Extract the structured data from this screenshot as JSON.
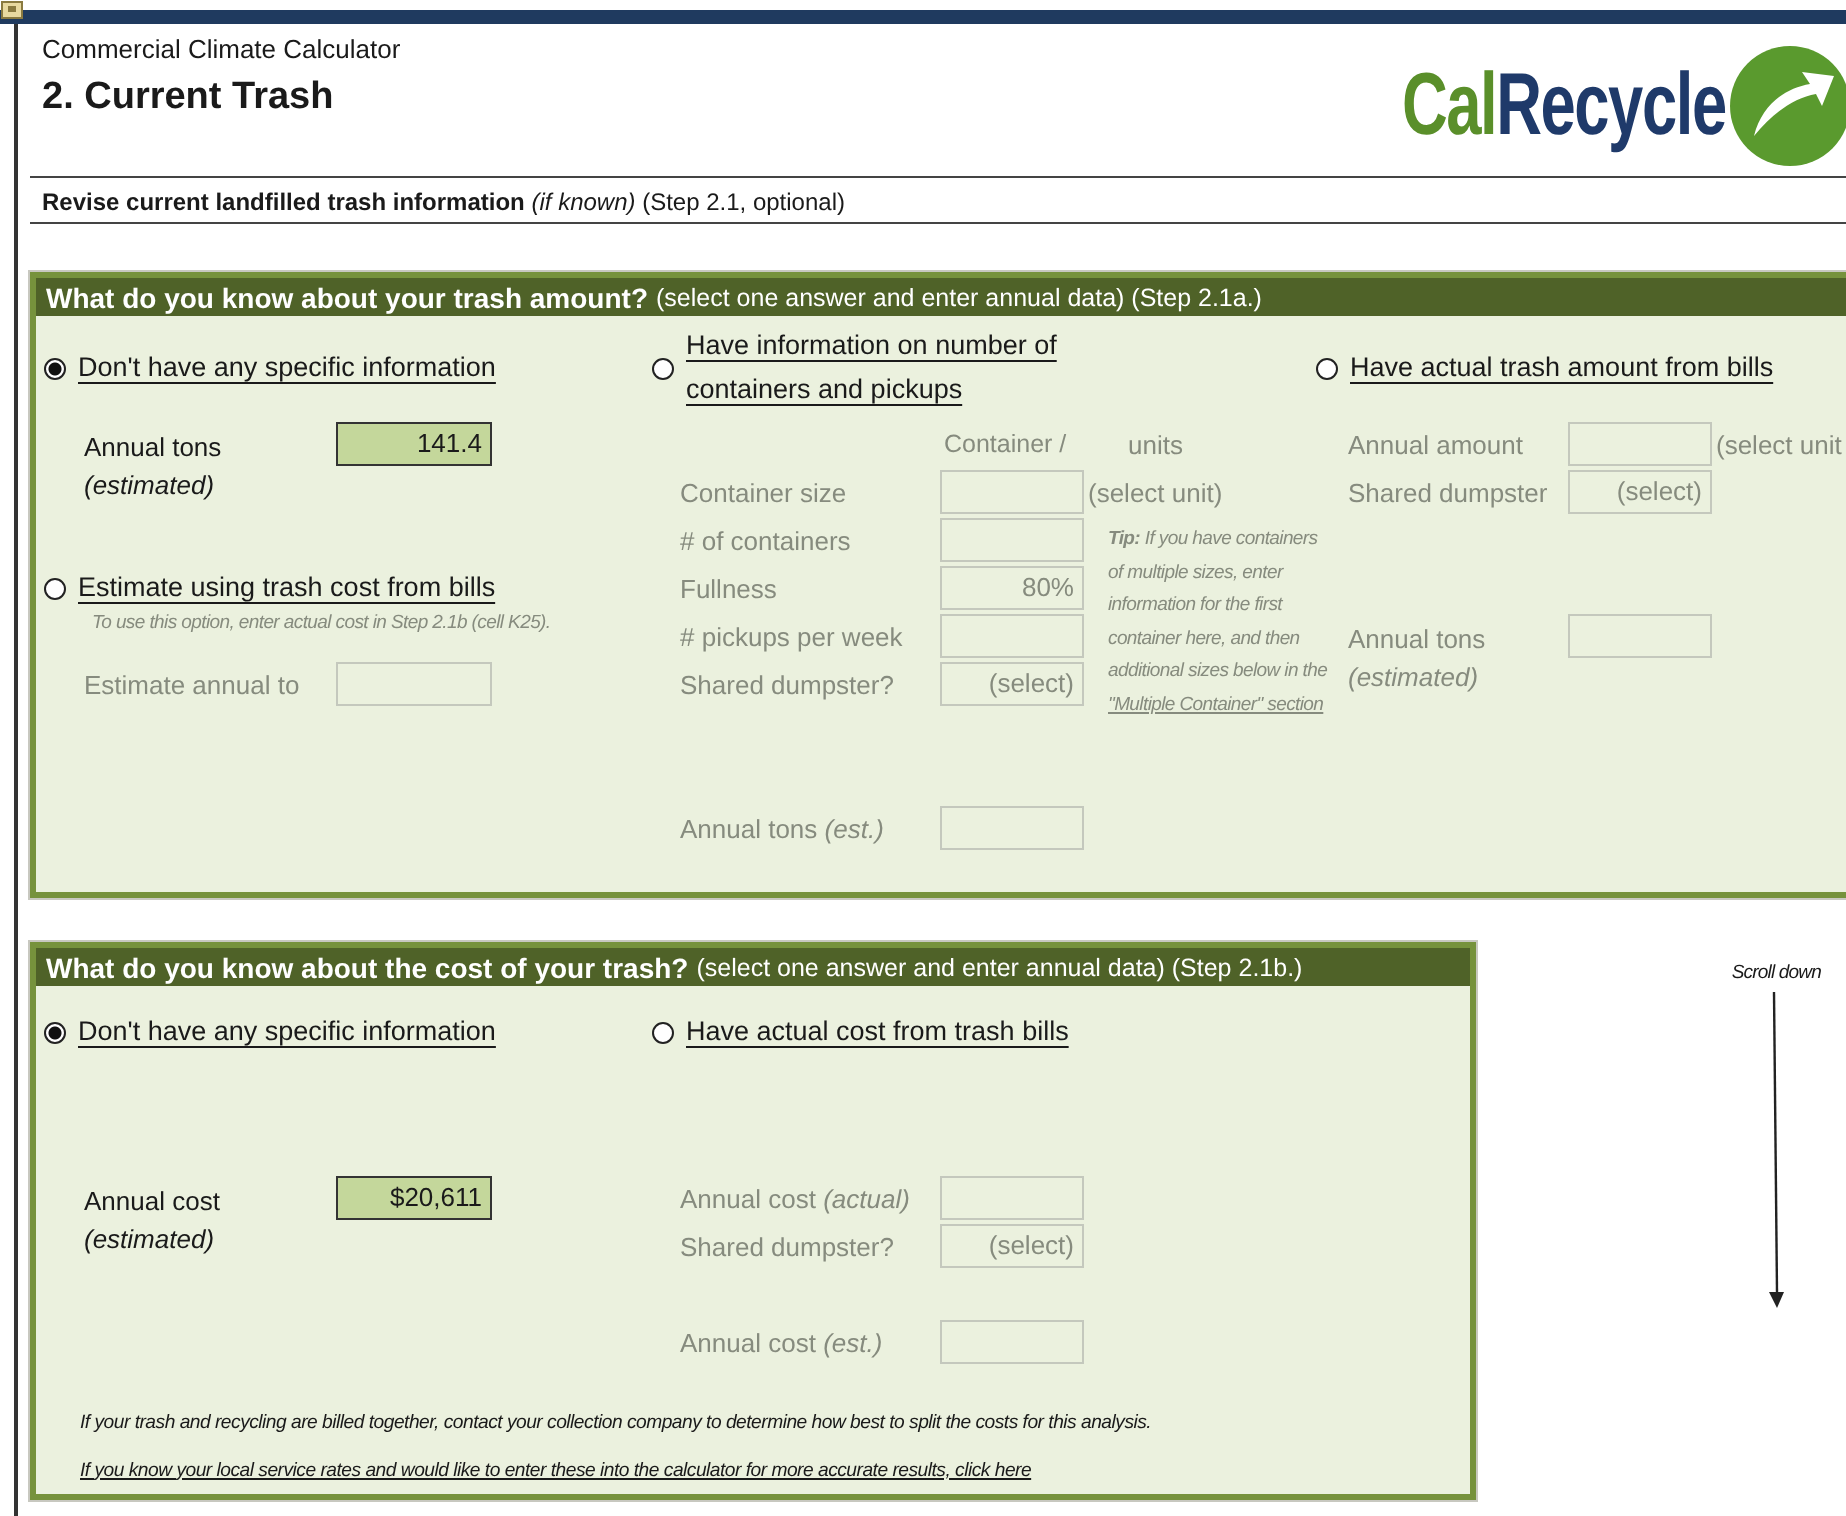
{
  "header": {
    "app_title": "Commercial Climate Calculator",
    "page_title": "2. Current Trash",
    "logo": {
      "first": "Cal",
      "second": "Recycle"
    }
  },
  "instruction": "**Revise current landfilled trash information** *(if known)*  (Step 2.1, optional)",
  "amount_panel": {
    "title": "What do you know about your trash amount?",
    "subtitle": "(select one answer and enter annual data) (Step 2.1a.)",
    "options": [
      {
        "label": "Don't have any specific information",
        "selected": true
      },
      {
        "label": "Have information on number of containers and pickups",
        "selected": false
      },
      {
        "label": "Have actual trash amount from bills",
        "selected": false
      },
      {
        "label": "Estimate using trash cost from bills",
        "selected": false
      }
    ],
    "estimate": {
      "label": "Annual tons",
      "note": "(estimated)",
      "value": "141.4"
    },
    "cost_method": {
      "hint": "To use this option, enter actual cost in Step 2.1b (cell K25).",
      "label": "Estimate annual to"
    },
    "containers": {
      "column_1": "Container /",
      "column_2": "units",
      "rows": [
        {
          "label": "Container size",
          "unit": "(select unit)"
        },
        {
          "label": "# of containers"
        },
        {
          "label": "Fullness",
          "value": "80%"
        },
        {
          "label": "# pickups per week"
        },
        {
          "label": "Shared dumpster?",
          "value": "(select)"
        }
      ],
      "tip": "**Tip:**    If you have containers of multiple sizes, enter information for the first container here, and then additional sizes below in the",
      "tip_link": "\"Multiple Container\" section",
      "result": {
        "label": "Annual tons",
        "note": "(est.)"
      }
    },
    "bills": {
      "rows": [
        {
          "label": "Annual amount",
          "unit": "(select unit"
        },
        {
          "label": "Shared dumpster",
          "value": "(select)"
        }
      ],
      "result": {
        "label": "Annual tons",
        "note": "(estimated)"
      }
    }
  },
  "cost_panel": {
    "title": "What do you know about the cost of your trash?",
    "subtitle": "(select one answer and enter annual data) (Step 2.1b.)",
    "options": [
      {
        "label": "Don't have any specific information",
        "selected": true
      },
      {
        "label": "Have actual cost from trash bills",
        "selected": false
      }
    ],
    "estimate": {
      "label": "Annual cost",
      "note": "(estimated)",
      "value": "$20,611"
    },
    "actual": {
      "rows": [
        {
          "label": "Annual cost",
          "note": "(actual)"
        },
        {
          "label": "Shared dumpster?",
          "value": "(select)"
        }
      ],
      "result": {
        "label": "Annual cost",
        "note": "(est.)"
      }
    },
    "notes": [
      {
        "kind": "text",
        "text": "If your trash and recycling are billed together, contact your collection company to determine how best to split the costs for this analysis."
      },
      {
        "kind": "link",
        "text": "If you know your local service rates and would like to enter these into the calculator for more accurate results, click here"
      }
    ]
  },
  "scroll_hint": "Scroll down"
}
